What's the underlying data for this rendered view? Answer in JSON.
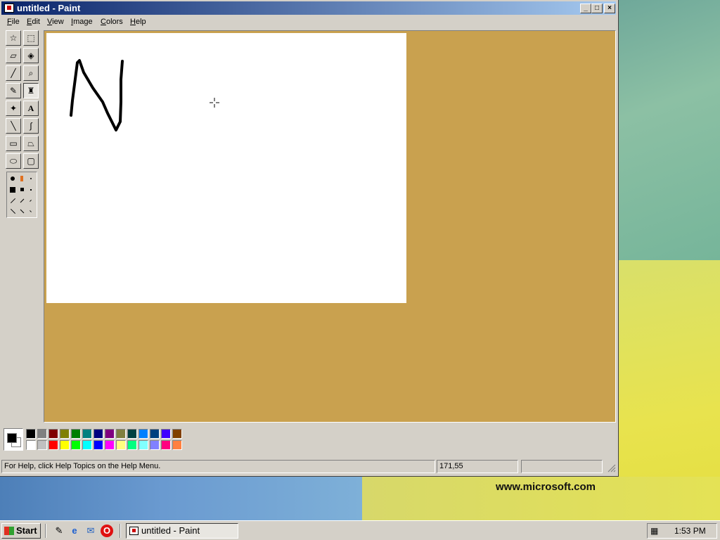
{
  "window": {
    "title": "untitled - Paint",
    "buttons": {
      "minimize": "_",
      "maximize": "□",
      "close": "×"
    }
  },
  "menu": [
    {
      "label": "File"
    },
    {
      "label": "Edit"
    },
    {
      "label": "View"
    },
    {
      "label": "Image"
    },
    {
      "label": "Colors"
    },
    {
      "label": "Help"
    }
  ],
  "tools": [
    {
      "name": "free-form-select-icon",
      "glyph": "☆"
    },
    {
      "name": "select-icon",
      "glyph": "⬚"
    },
    {
      "name": "eraser-icon",
      "glyph": "▱"
    },
    {
      "name": "fill-icon",
      "glyph": "◈"
    },
    {
      "name": "pick-color-icon",
      "glyph": "╱"
    },
    {
      "name": "magnifier-icon",
      "glyph": "⌕"
    },
    {
      "name": "pencil-icon",
      "glyph": "✎",
      "pressed": false
    },
    {
      "name": "brush-icon",
      "glyph": "♜",
      "pressed": true
    },
    {
      "name": "airbrush-icon",
      "glyph": "✦"
    },
    {
      "name": "text-icon",
      "glyph": "A"
    },
    {
      "name": "line-icon",
      "glyph": "╲"
    },
    {
      "name": "curve-icon",
      "glyph": "∫"
    },
    {
      "name": "rectangle-icon",
      "glyph": "▭"
    },
    {
      "name": "polygon-icon",
      "glyph": "⏢"
    },
    {
      "name": "ellipse-icon",
      "glyph": "⬭"
    },
    {
      "name": "rounded-rectangle-icon",
      "glyph": "▢"
    }
  ],
  "palette": {
    "foreground": "#000000",
    "background": "#ffffff",
    "colors_top": [
      "#000000",
      "#808080",
      "#800000",
      "#808000",
      "#008000",
      "#008080",
      "#000080",
      "#800080",
      "#808040",
      "#004040",
      "#0080ff",
      "#004080",
      "#4000ff",
      "#804000"
    ],
    "colors_bottom": [
      "#ffffff",
      "#c0c0c0",
      "#ff0000",
      "#ffff00",
      "#00ff00",
      "#00ffff",
      "#0000ff",
      "#ff00ff",
      "#ffff80",
      "#00ff80",
      "#80ffff",
      "#8080ff",
      "#ff0080",
      "#ff8040"
    ]
  },
  "status": {
    "help": "For Help, click Help Topics on the Help Menu.",
    "coords": "171,55",
    "size": ""
  },
  "desktop": {
    "url": "www.microsoft.com"
  },
  "taskbar": {
    "start_label": "Start",
    "quick_launch": [
      {
        "name": "show-desktop-icon",
        "glyph": "✎"
      },
      {
        "name": "internet-explorer-icon",
        "glyph": "e"
      },
      {
        "name": "outlook-express-icon",
        "glyph": "✉"
      },
      {
        "name": "opera-icon",
        "glyph": "O"
      }
    ],
    "task_label": "untitled - Paint",
    "clock": "1:53 PM"
  },
  "colors": {
    "titlebar_start": "#0a246a",
    "titlebar_end": "#a6caf0",
    "canvas_bg": "#c9a14f",
    "chrome": "#d4d0c8"
  }
}
